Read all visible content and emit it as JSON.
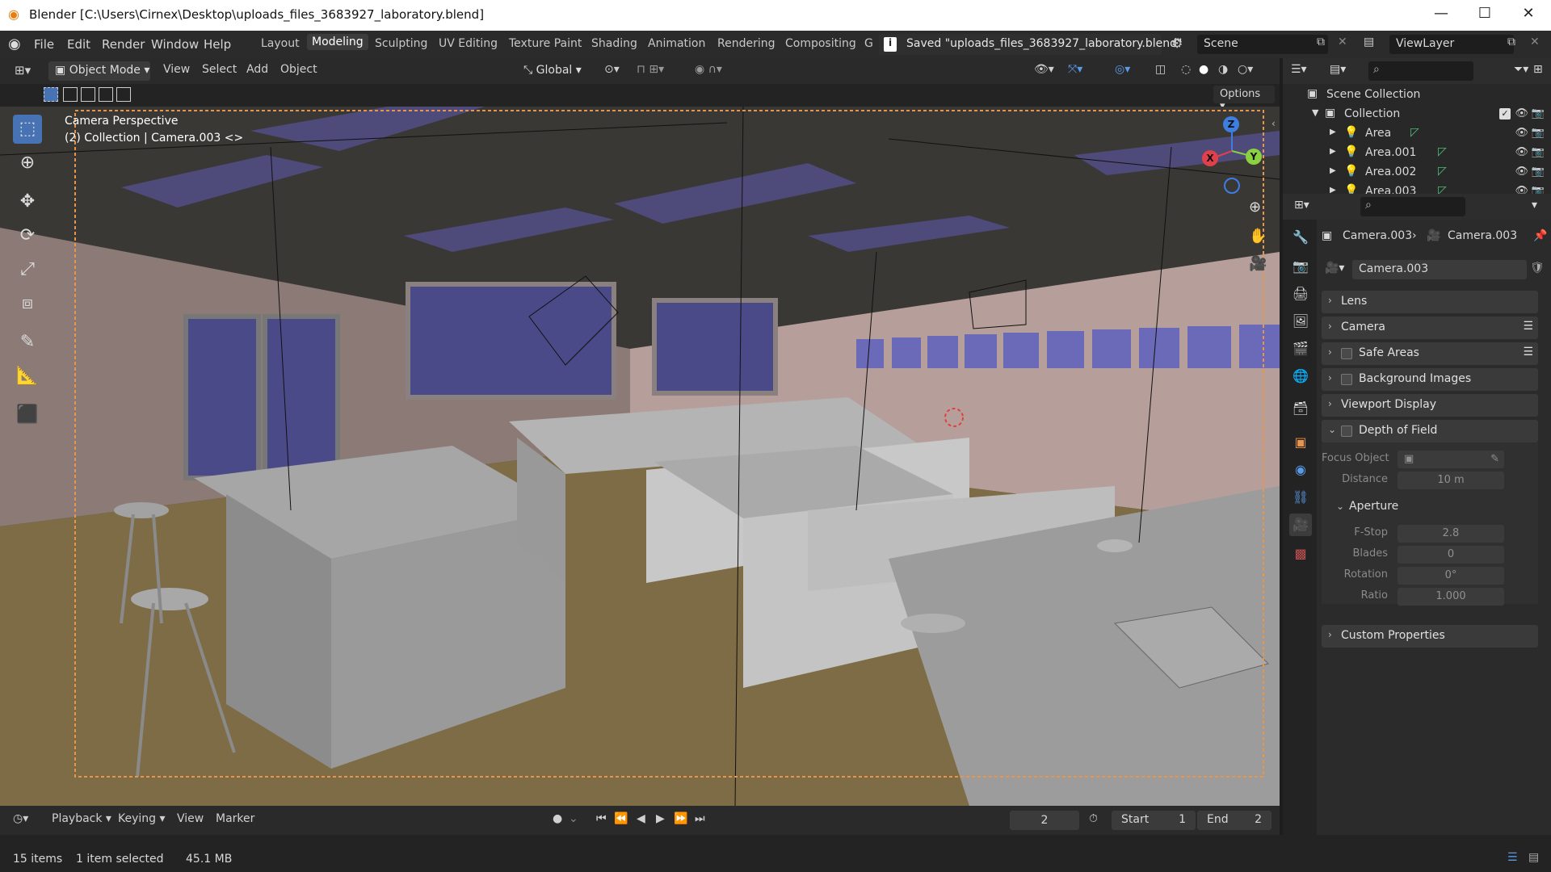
{
  "window": {
    "title": "Blender [C:\\Users\\Cirnex\\Desktop\\uploads_files_3683927_laboratory.blend]"
  },
  "menu": {
    "file": "File",
    "edit": "Edit",
    "render": "Render",
    "window": "Window",
    "help": "Help"
  },
  "workspaces": [
    "Layout",
    "Modeling",
    "Sculpting",
    "UV Editing",
    "Texture Paint",
    "Shading",
    "Animation",
    "Rendering",
    "Compositing",
    "G"
  ],
  "notification": "Saved \"uploads_files_3683927_laboratory.blend\"",
  "scene": {
    "name": "Scene"
  },
  "viewlayer": {
    "name": "ViewLayer"
  },
  "viewport_header": {
    "mode": "Object Mode",
    "view": "View",
    "select": "Select",
    "add": "Add",
    "object": "Object",
    "transform": "Global",
    "options": "Options"
  },
  "viewport": {
    "perspective": "Camera Perspective",
    "collection": "(2) Collection | Camera.003 <>",
    "gizmo": {
      "z": "Z",
      "y": "Y",
      "x": "X"
    }
  },
  "outliner": {
    "scene_collection": "Scene Collection",
    "collection": "Collection",
    "items": [
      "Area",
      "Area.001",
      "Area.002",
      "Area.003"
    ]
  },
  "properties": {
    "breadcrumb": {
      "object": "Camera.003",
      "data": "Camera.003"
    },
    "datablock": "Camera.003",
    "panels": {
      "lens": "Lens",
      "camera": "Camera",
      "safe_areas": "Safe Areas",
      "background_images": "Background Images",
      "viewport_display": "Viewport Display",
      "depth_of_field": "Depth of Field",
      "custom_properties": "Custom Properties"
    },
    "dof": {
      "focus_object_label": "Focus Object",
      "distance_label": "Distance",
      "distance_value": "10 m",
      "aperture": "Aperture",
      "fstop_label": "F-Stop",
      "fstop_value": "2.8",
      "blades_label": "Blades",
      "blades_value": "0",
      "rotation_label": "Rotation",
      "rotation_value": "0°",
      "ratio_label": "Ratio",
      "ratio_value": "1.000"
    }
  },
  "timeline": {
    "playback": "Playback",
    "keying": "Keying",
    "view": "View",
    "marker": "Marker",
    "current_frame": "2",
    "start_label": "Start",
    "start_value": "1",
    "end_label": "End",
    "end_value": "2"
  },
  "status": {
    "items": "15 items",
    "selected": "1 item selected",
    "memory": "45.1 MB"
  },
  "colors": {
    "accent": "#4772b3",
    "active_border": "#e8944a",
    "x_axis": "#e0404a",
    "y_axis": "#8ad040",
    "z_axis": "#3d7ee0"
  }
}
